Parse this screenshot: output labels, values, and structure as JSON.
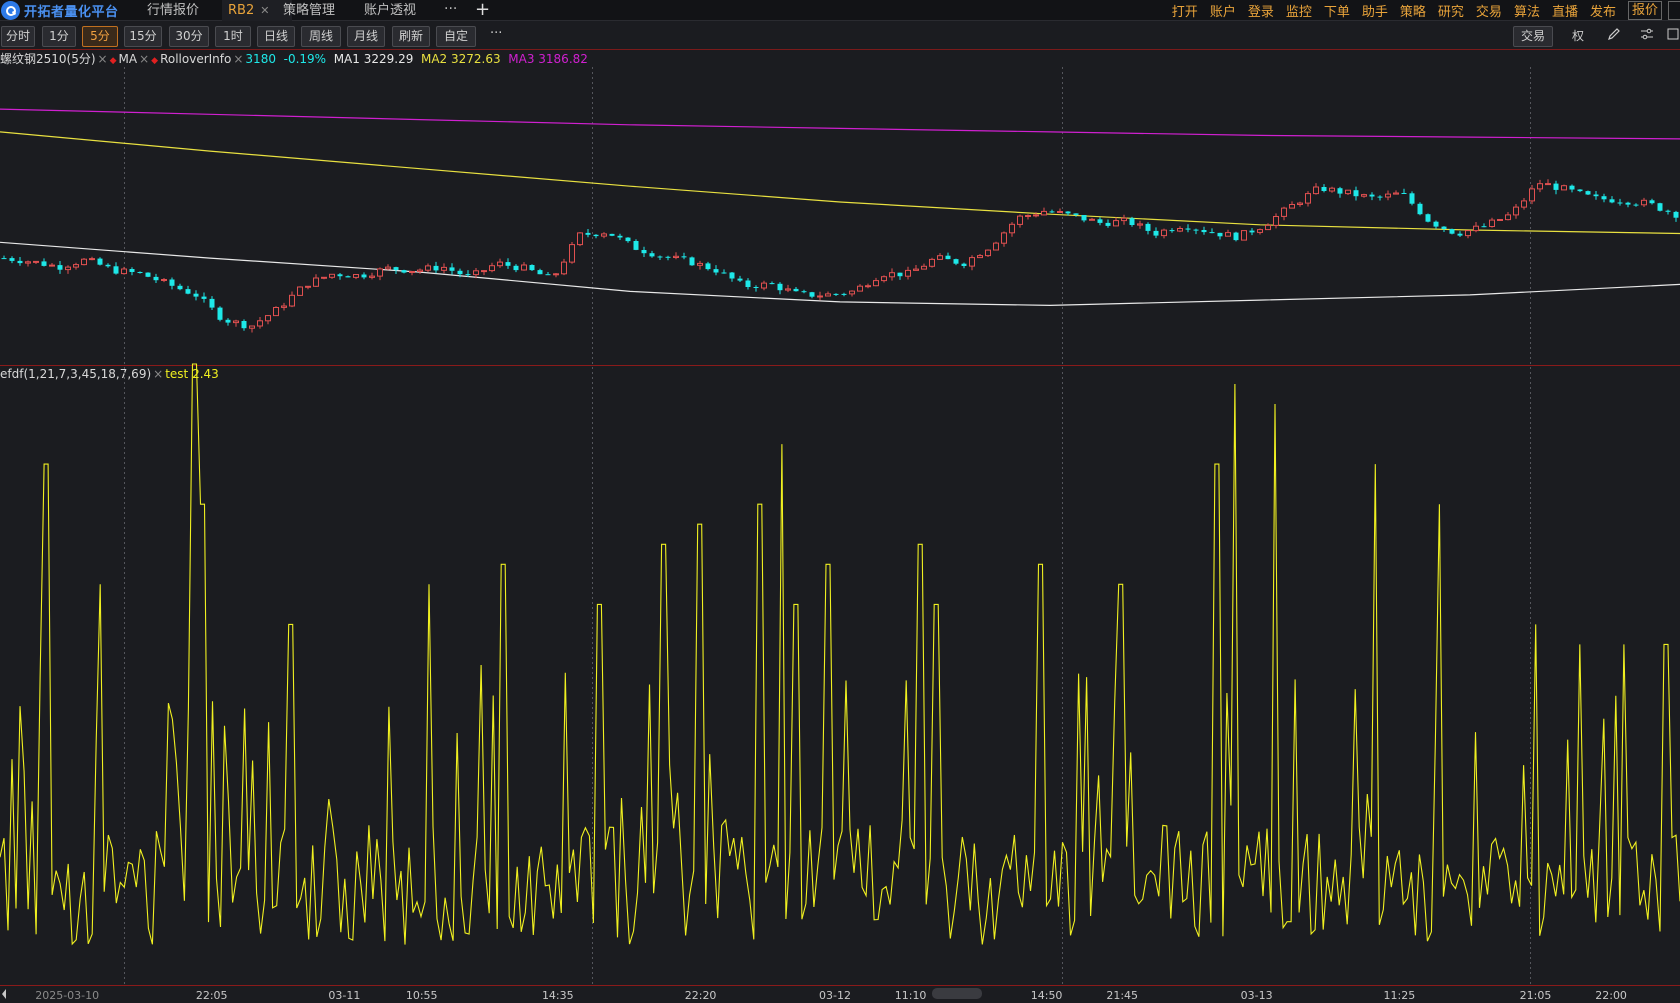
{
  "app": {
    "name": "开拓者量化平台",
    "tabs": [
      {
        "label": "行情报价",
        "active": false
      },
      {
        "label": "RB2",
        "active": true
      },
      {
        "label": "策略管理",
        "active": false
      },
      {
        "label": "账户透视",
        "active": false
      }
    ],
    "tab_more": "···",
    "tab_add": "+",
    "menu": [
      "打开",
      "账户",
      "登录",
      "监控",
      "下单",
      "助手",
      "策略",
      "研究",
      "交易",
      "算法",
      "直播",
      "发布",
      "报价"
    ]
  },
  "periods": {
    "buttons": [
      "分时",
      "1分",
      "5分",
      "15分",
      "30分",
      "1时",
      "日线",
      "周线",
      "月线",
      "刷新",
      "自定"
    ],
    "active": "5分",
    "more": "···",
    "trade_button": "交易",
    "right_icons": [
      "权",
      "pencil-icon",
      "settings-icon",
      "toggle-icon"
    ]
  },
  "legend_main": {
    "symbol": "螺纹钢2510(5分)",
    "close": "×",
    "ma_label": "MA",
    "rollover_label": "RolloverInfo",
    "last_price": "3180",
    "change_pct": "-0.19%",
    "ma1": "MA1 3229.29",
    "ma2": "MA2 3272.63",
    "ma3": "MA3 3186.82"
  },
  "legend_sub": {
    "indicator": "efdf(1,21,7,3,45,18,7,69)",
    "close": "×",
    "value": "test 2.43"
  },
  "time_axis": {
    "labels": [
      {
        "text": "2025-03-10",
        "x": 0.04,
        "dim": true
      },
      {
        "text": "22:05",
        "x": 0.126
      },
      {
        "text": "03-11",
        "x": 0.205
      },
      {
        "text": "10:55",
        "x": 0.251
      },
      {
        "text": "14:35",
        "x": 0.332
      },
      {
        "text": "22:20",
        "x": 0.417
      },
      {
        "text": "03-12",
        "x": 0.497
      },
      {
        "text": "11:10",
        "x": 0.542
      },
      {
        "text": "14:50",
        "x": 0.623
      },
      {
        "text": "21:45",
        "x": 0.668
      },
      {
        "text": "03-13",
        "x": 0.748
      },
      {
        "text": "11:25",
        "x": 0.833
      },
      {
        "text": "21:05",
        "x": 0.914
      },
      {
        "text": "22:00",
        "x": 0.959
      }
    ]
  },
  "colors": {
    "up": "#e05050",
    "down": "#1ee8e8",
    "ma1": "#e8e8e8",
    "ma2": "#e8e040",
    "ma3": "#d020d0",
    "indicator": "#f0f020",
    "accent": "#e8a33a",
    "pct": "#1ee8e8"
  },
  "chart_data": [
    {
      "type": "candlestick",
      "title": "螺纹钢2510(5分)",
      "ylim": [
        3140,
        3310
      ],
      "close_series_sample": [
        3201,
        3199,
        3196,
        3200,
        3194,
        3192,
        3186,
        3180,
        3166,
        3162,
        3172,
        3186,
        3192,
        3191,
        3195,
        3194,
        3196,
        3190,
        3198,
        3195,
        3189,
        3214,
        3216,
        3207,
        3202,
        3199,
        3194,
        3185,
        3186,
        3180,
        3180,
        3182,
        3192,
        3192,
        3201,
        3198,
        3208,
        3224,
        3228,
        3225,
        3221,
        3222,
        3215,
        3220,
        3216,
        3213,
        3220,
        3231,
        3241,
        3238,
        3235,
        3238,
        3222,
        3215,
        3219,
        3226,
        3244,
        3240,
        3235,
        3234,
        3232,
        3226
      ],
      "ma1": [
        3210,
        3201,
        3193,
        3182,
        3176,
        3174,
        3177,
        3180,
        3186
      ],
      "ma2": [
        3273,
        3262,
        3252,
        3242,
        3233,
        3226,
        3220,
        3217,
        3215
      ],
      "ma3": [
        3286,
        3283,
        3280,
        3277,
        3275,
        3273,
        3271,
        3270,
        3269
      ]
    },
    {
      "type": "line",
      "series": [
        {
          "name": "test",
          "last": 2.43
        }
      ],
      "ylim": [
        0,
        30
      ]
    }
  ]
}
